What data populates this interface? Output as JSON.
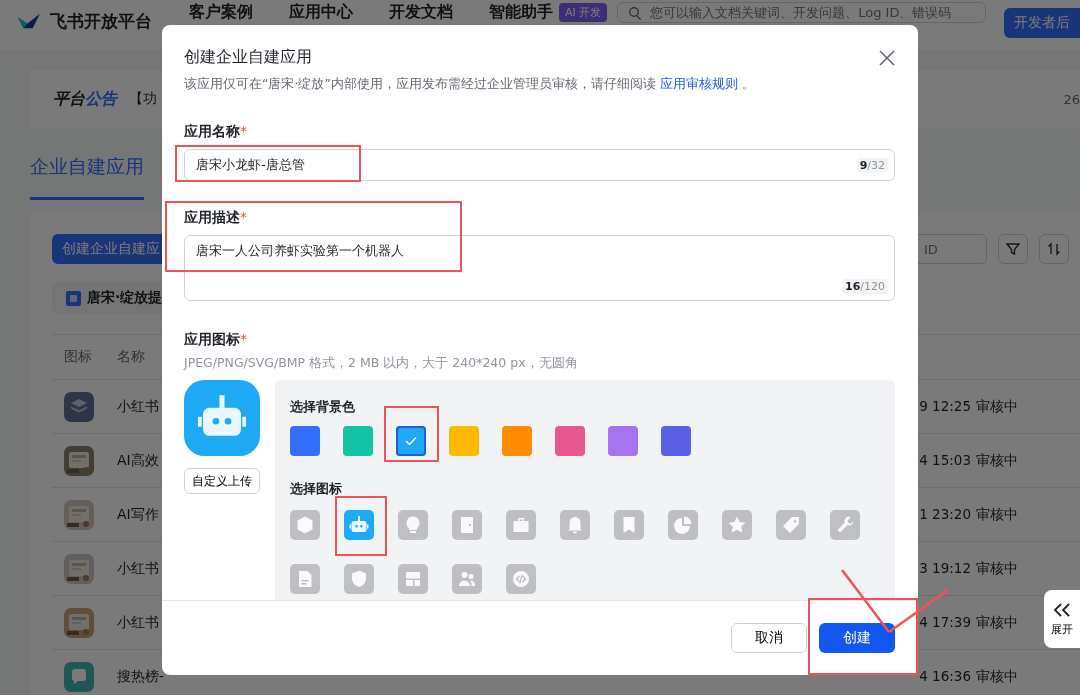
{
  "header": {
    "logo": "飞书开放平台",
    "nav": [
      {
        "label": "客户案例"
      },
      {
        "label": "应用中心"
      },
      {
        "label": "开发文档"
      },
      {
        "label": "智能助手"
      }
    ],
    "badge": "AI 开发",
    "search": {
      "placeholder": "您可以输入文档关键词、开发问题、Log ID、错误码"
    },
    "button": "开发者后"
  },
  "announcement": {
    "label": "平台",
    "accent": "公告",
    "text": "【功",
    "count": "26"
  },
  "tabs": [
    {
      "label": "企业自建应用",
      "selected": true
    }
  ],
  "toolbar": {
    "create_button": "创建企业自建应",
    "search_placeholder": "ID"
  },
  "tenant_tag": "唐宋·绽放提",
  "table": {
    "columns": [
      "图标",
      "名称"
    ],
    "rows": [
      {
        "kind": "layers",
        "name": "小红书",
        "time": "9 12:25",
        "status": "审核中"
      },
      {
        "kind": "picture",
        "name": "AI高效",
        "time": "4 15:03",
        "status": "审核中"
      },
      {
        "kind": "picture",
        "name": "AI写作",
        "time": "1 23:20",
        "status": "审核中"
      },
      {
        "kind": "picture",
        "name": "小红书",
        "time": "3 19:12",
        "status": "审核中"
      },
      {
        "kind": "picture",
        "name": "小红书",
        "time": "4 17:39",
        "status": "审核中"
      },
      {
        "kind": "chat",
        "name": "搜热榜-",
        "time": "4 16:36",
        "status": "审核中"
      }
    ]
  },
  "expand_button": {
    "label": "展开"
  },
  "dialog": {
    "title": "创建企业自建应用",
    "notice": "该应用仅可在“唐宋·绽放”内部使用，应用发布需经过企业管理员审核，请仔细阅读 ",
    "notice_link": "应用审核规则",
    "notice_end": " 。",
    "fields": [
      {
        "kind": "input",
        "label": "应用名称",
        "mark": "*",
        "value": "唐宋小龙虾-唐总管",
        "count": "9",
        "limit": "/32"
      },
      {
        "kind": "textarea",
        "label": "应用描述",
        "mark": "*",
        "value": "唐宋一人公司养虾实验第一个机器人",
        "count": "16",
        "limit": "/120"
      }
    ],
    "icon_section": {
      "label": "应用图标",
      "mark": "*",
      "hint": "JPEG/PNG/SVG/BMP 格式，2 MB 以内，大于 240*240 px，无圆角",
      "upload_button": "自定义上传",
      "color_label": "选择背景色",
      "colors": [
        {
          "color": "#3370ff",
          "selected": false
        },
        {
          "color": "#14c4a2",
          "selected": false
        },
        {
          "color": "#1eaaf5",
          "selected": true
        },
        {
          "color": "#ffba00",
          "selected": false
        },
        {
          "color": "#ff8b00",
          "selected": false
        },
        {
          "color": "#e8578f",
          "selected": false
        },
        {
          "color": "#a572f0",
          "selected": false
        },
        {
          "color": "#5b5fe3",
          "selected": false
        }
      ],
      "icon_label": "选择图标",
      "icons": [
        {
          "kind": "box",
          "selected": false
        },
        {
          "kind": "robot",
          "selected": true
        },
        {
          "kind": "bulb",
          "selected": false
        },
        {
          "kind": "door",
          "selected": false
        },
        {
          "kind": "briefcase",
          "selected": false
        },
        {
          "kind": "bell",
          "selected": false
        },
        {
          "kind": "bookmark",
          "selected": false
        },
        {
          "kind": "pie",
          "selected": false
        },
        {
          "kind": "star",
          "selected": false
        },
        {
          "kind": "tag",
          "selected": false
        },
        {
          "kind": "wrench",
          "selected": false
        },
        {
          "kind": "doc",
          "selected": false
        },
        {
          "kind": "shield",
          "selected": false
        },
        {
          "kind": "layout",
          "selected": false
        },
        {
          "kind": "people",
          "selected": false
        },
        {
          "kind": "code",
          "selected": false
        }
      ]
    },
    "buttons": [
      {
        "kind": "secondary",
        "label": "取消"
      },
      {
        "kind": "primary",
        "label": "创建"
      }
    ]
  }
}
